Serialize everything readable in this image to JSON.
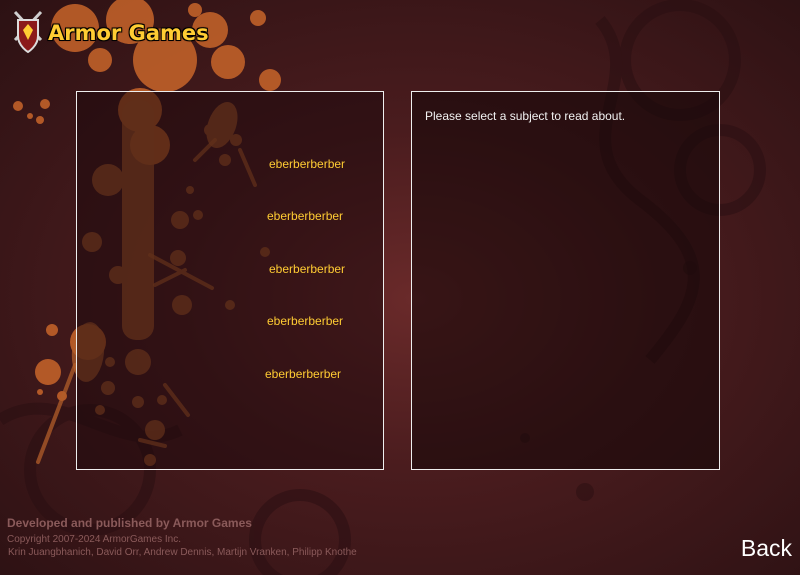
{
  "brand": {
    "name": "Armor Games"
  },
  "subjects": [
    "eberberberber",
    "eberberberber",
    "eberberberber",
    "eberberberber",
    "eberberberber"
  ],
  "info": {
    "prompt": "Please select a subject to read about."
  },
  "footer": {
    "developed": "Developed and published by Armor Games",
    "copyright": "Copyright 2007-2024 ArmorGames Inc.",
    "credits": "Krin Juangbhanich, David Orr, Andrew Dennis, Martijn Vranken, Philipp Knothe"
  },
  "nav": {
    "back_label": "Back"
  },
  "colors": {
    "accent": "#ffcc33",
    "splatter": "#c8652a",
    "background": "#4a1c1e"
  }
}
